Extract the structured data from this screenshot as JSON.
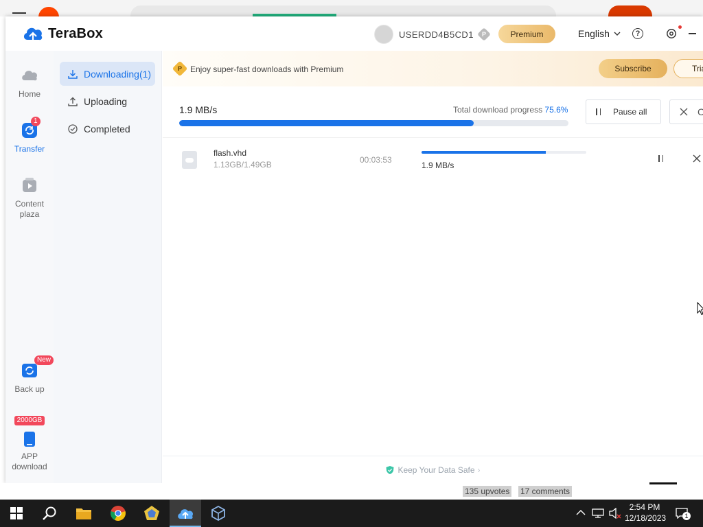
{
  "app": {
    "brand": "TeraBox",
    "user_name": "USERDD4B5CD1",
    "user_badge": "P",
    "premium_label": "Premium",
    "language": "English",
    "help_label": "?"
  },
  "leftnav": {
    "items": [
      {
        "label": "Home"
      },
      {
        "label": "Transfer",
        "badge": "1"
      },
      {
        "label": "Content plaza"
      },
      {
        "label": "Back up",
        "badge": "New"
      },
      {
        "label": "APP download",
        "badge": "2000GB"
      }
    ]
  },
  "subnav": {
    "items": [
      {
        "label": "Downloading(1)"
      },
      {
        "label": "Uploading"
      },
      {
        "label": "Completed"
      }
    ]
  },
  "banner": {
    "badge": "P",
    "text": "Enjoy super-fast downloads with Premium",
    "subscribe_label": "Subscribe",
    "trial_label": "Tria"
  },
  "summary": {
    "speed": "1.9 MB/s",
    "progress_label": "Total download progress",
    "progress_pct": "75.6%",
    "progress_value": 0.756,
    "pause_all_label": "Pause all",
    "cancel_all_label": "C"
  },
  "downloads": [
    {
      "name": "flash.vhd",
      "size": "1.13GB/1.49GB",
      "time_left": "00:03:53",
      "speed": "1.9 MB/s",
      "progress_value": 0.756
    }
  ],
  "footer": {
    "text": "Keep Your Data Safe",
    "chevron": "›"
  },
  "background": {
    "upvotes": "135 upvotes",
    "comments": "17 comments"
  },
  "taskbar": {
    "time": "2:54 PM",
    "date": "12/18/2023",
    "notification_count": "1"
  },
  "colors": {
    "accent": "#1a73e8",
    "premium_gold": "#eab96a",
    "badge_red": "#f2485b",
    "taskbar": "#1b1b1b"
  },
  "icons": {
    "brand": "cloud-logo-icon",
    "home": "cloud-icon",
    "transfer": "sync-icon",
    "content": "play-icon",
    "backup": "backup-icon",
    "app": "phone-icon"
  }
}
